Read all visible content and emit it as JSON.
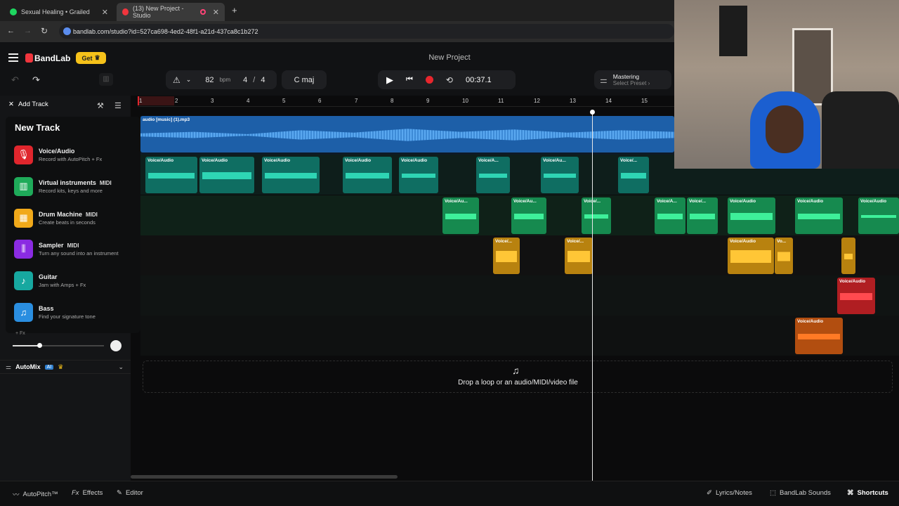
{
  "browser": {
    "tabs": [
      {
        "label": "Sexual Healing • Grailed",
        "active": false
      },
      {
        "label": "(13) New Project - Studio",
        "active": true
      }
    ],
    "new_tab_icon": "+",
    "url": "bandlab.com/studio?id=527ca698-4ed2-48f1-a21d-437ca8c1b272"
  },
  "app": {
    "brand": "BandLab",
    "get_button": "Get",
    "project_title": "New Project",
    "tempo": "82",
    "tempo_unit": "bpm",
    "time_sig_num": "4",
    "time_sig_den": "4",
    "key": "C maj",
    "time": "00:37.1",
    "mastering_label": "Mastering",
    "mastering_preset": "Select Preset ›",
    "add_track": "Add Track",
    "new_track_title": "New Track",
    "new_track_items": [
      {
        "title": "Voice/Audio",
        "midi": "",
        "sub": "Record with AutoPitch + Fx",
        "color": "#e0262d",
        "icon": "mic-icon"
      },
      {
        "title": "Virtual instruments",
        "midi": "MIDI",
        "sub": "Record kits, keys and more",
        "color": "#1fab5a",
        "icon": "keyboard-icon"
      },
      {
        "title": "Drum Machine",
        "midi": "MIDI",
        "sub": "Create beats in seconds",
        "color": "#f1a91a",
        "icon": "drum-pad-icon"
      },
      {
        "title": "Sampler",
        "midi": "MIDI",
        "sub": "Turn any sound into an instrument",
        "color": "#8a2be2",
        "icon": "waveform-icon"
      },
      {
        "title": "Guitar",
        "midi": "",
        "sub": "Jam with Amps + Fx",
        "color": "#17a8a0",
        "icon": "guitar-icon"
      },
      {
        "title": "Bass",
        "midi": "",
        "sub": "Find your signature tone",
        "color": "#2a8ee0",
        "icon": "bass-icon"
      }
    ],
    "fx_label": "+ Fx",
    "automix": "AutoMix",
    "automix_badge": "AI",
    "ruler_ticks": [
      "1",
      "2",
      "3",
      "4",
      "5",
      "6",
      "7",
      "8",
      "9",
      "10",
      "11",
      "12",
      "13",
      "14",
      "15"
    ],
    "audio_track_name": "audio [music] (1).mp3",
    "clip_labels": {
      "voice": "Voice/Audio",
      "voice_a": "Voice/A...",
      "voice_au": "Voice/Au...",
      "voice_short": "Voice/...",
      "vo": "Vo..."
    },
    "drop_text": "Drop a loop or an audio/MIDI/video file",
    "bottom": {
      "autopitch": "AutoPitch™",
      "effects": "Effects",
      "editor": "Editor",
      "lyrics": "Lyrics/Notes",
      "sounds": "BandLab Sounds",
      "shortcuts": "Shortcuts"
    },
    "colors": {
      "accent_gold": "#f6c21a",
      "brand_red": "#f0353d",
      "audio_blue": "#2f7fd0",
      "teal": "#19a58c",
      "green": "#22c07a",
      "orange": "#e2a01d",
      "red": "#d9262b",
      "deep_orange": "#dc6a1a"
    }
  }
}
